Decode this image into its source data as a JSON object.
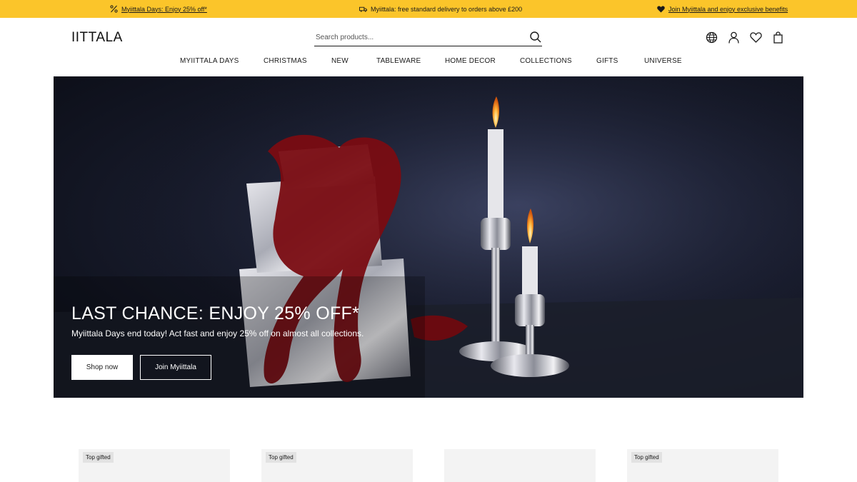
{
  "promo_bar": {
    "left_text": "Myiittala Days: Enjoy 25% off*",
    "left_icon": "percent-icon",
    "center_text": "Myiittala: free standard delivery to orders above £200",
    "center_icon": "truck-icon",
    "right_text": "Join Myiittala and enjoy exclusive benefits",
    "right_icon": "heart-icon",
    "background_color": "#fbc52a"
  },
  "header": {
    "logo": "IITTALA",
    "search_placeholder": "Search products...",
    "icons": [
      "globe-icon",
      "account-icon",
      "wishlist-icon",
      "bag-icon"
    ]
  },
  "nav": {
    "items": [
      "MYIITTALA DAYS",
      "CHRISTMAS",
      "NEW",
      "TABLEWARE",
      "HOME DECOR",
      "COLLECTIONS",
      "GIFTS",
      "UNIVERSE"
    ]
  },
  "hero": {
    "title": "LAST CHANCE: ENJOY 25% OFF*",
    "subtitle": "Myiittala Days end today! Act fast and enjoy 25% off on almost all collections.",
    "primary_button": "Shop now",
    "secondary_button": "Join Myiittala"
  },
  "products": [
    {
      "badge": "Top gifted"
    },
    {
      "badge": "Top gifted"
    },
    {
      "badge": ""
    },
    {
      "badge": "Top gifted"
    }
  ]
}
